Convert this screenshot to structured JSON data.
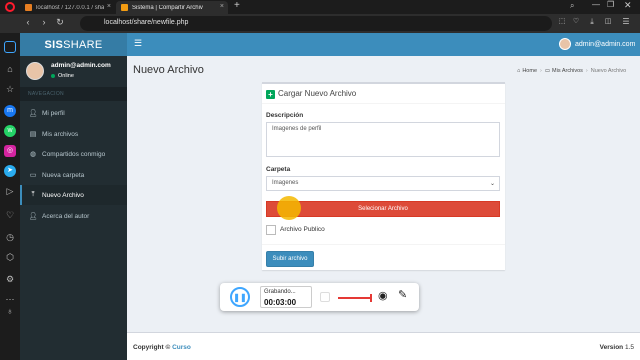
{
  "browser": {
    "tabs": [
      {
        "title": "localhost / 127.0.0.1 / share",
        "active": false,
        "favicon_color": "#e67e22"
      },
      {
        "title": "Sistema | Compartir Archiv",
        "active": true,
        "favicon_color": "#f39c12"
      }
    ],
    "new_tab": "+",
    "url": "localhost/share/newfile.php",
    "colors": {
      "opera_red": "#ff1b2d"
    }
  },
  "opera_sidebar": {
    "icons": [
      "opera-logo",
      "home-icon",
      "star-icon",
      "messenger-icon",
      "whatsapp-icon",
      "instagram-icon",
      "telegram-icon",
      "send-icon",
      "heart-icon",
      "clock-icon",
      "cube-icon",
      "settings-icon",
      "more-icon",
      "bulb-icon"
    ]
  },
  "app": {
    "logo_bold": "SIS",
    "logo_rest": "SHARE",
    "user_email": "admin@admin.com",
    "user_status": "Online",
    "nav_header": "NAVEGACION",
    "menu": [
      {
        "label": "Mi perfil",
        "icon": "user-icon",
        "active": false
      },
      {
        "label": "Mis archivos",
        "icon": "file-icon",
        "active": false
      },
      {
        "label": "Compartidos conmigo",
        "icon": "globe-icon",
        "active": false
      },
      {
        "label": "Nueva carpeta",
        "icon": "folder-icon",
        "active": false
      },
      {
        "label": "Nuevo Archivo",
        "icon": "upload-icon",
        "active": true
      },
      {
        "label": "Acerca del autor",
        "icon": "info-icon",
        "active": false
      }
    ],
    "colors": {
      "logo_bg": "#357ca5",
      "header_bg": "#3c8dbc",
      "sidebar_bg": "#222d32",
      "online": "#00a65a"
    }
  },
  "page": {
    "title": "Nuevo Archivo",
    "breadcrumb": [
      "Home",
      "Mis Archivos",
      "Nuevo Archivo"
    ],
    "form": {
      "heading": "Cargar Nuevo Archivo",
      "description_label": "Descripción",
      "description_value": "Imagenes de perfil",
      "folder_label": "Carpeta",
      "folder_value": "Imagenes",
      "select_button": "Selecionar Archivo",
      "public_checkbox": "Archivo Publico",
      "submit_button": "Subir archivo"
    },
    "colors": {
      "danger": "#dd4b39",
      "primary": "#3c8dbc",
      "success": "#00a65a",
      "cursor_highlight": "#f5b800"
    }
  },
  "recorder": {
    "status": "Grabando...",
    "time": "00:03:00"
  },
  "footer": {
    "copyright_label": "Copyright ©",
    "copyright_link": "Curso",
    "version_label": "Version",
    "version_number": "1.5"
  }
}
